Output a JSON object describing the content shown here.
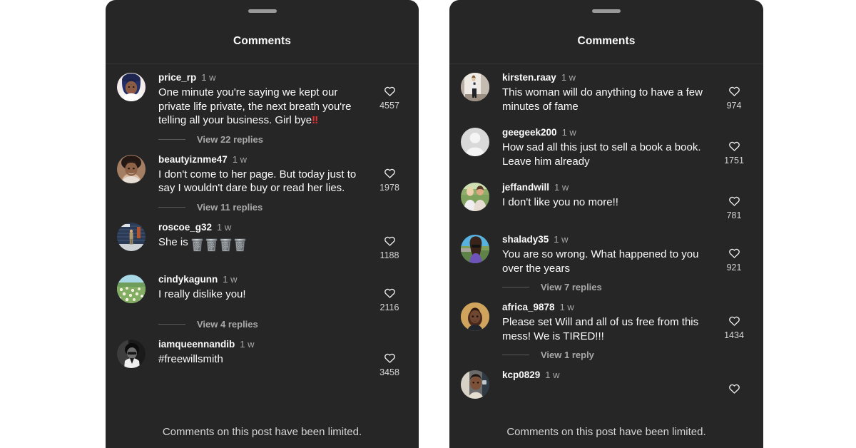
{
  "colors": {
    "page_background": "#ffffff",
    "sheet_background": "#262626",
    "primary_text": "#fafafa",
    "secondary_text": "#a8a8a8",
    "divider": "#333333",
    "accent_red": "#ef2f2f",
    "drag_handle": "#9a9a9a"
  },
  "panels": [
    {
      "id": "left",
      "title": "Comments",
      "drag_handle_name": "drag-handle",
      "footer_note": "Comments on this post have been limited.",
      "comments": [
        {
          "username": "price_rp",
          "age": "1 w",
          "text": "One minute you're saying we kept our private life private, the next breath you're telling all your business. Girl bye",
          "emoji_suffix": "‼",
          "likes": "4557",
          "replies_label": "View 22 replies",
          "avatar_type": "photo-woman-blue-hair"
        },
        {
          "username": "beautyiznme47",
          "age": "1 w",
          "text": "I don't come to her page. But today just to say I wouldn't dare buy or read her lies.",
          "likes": "1978",
          "replies_label": "View 11 replies",
          "avatar_type": "photo-woman-smiling"
        },
        {
          "username": "roscoe_g32",
          "age": "1 w",
          "text": "She is",
          "trash_emoji_count": 4,
          "likes": "1188",
          "replies_label": "",
          "avatar_type": "photo-man-standing"
        },
        {
          "username": "cindykagunn",
          "age": "1 w",
          "text": "I really dislike you!",
          "likes": "2116",
          "replies_label": "View 4 replies",
          "avatar_type": "photo-daisy-field"
        },
        {
          "username": "iamqueennandib",
          "age": "1 w",
          "text": "#freewillsmith",
          "likes": "3458",
          "replies_label": "",
          "avatar_type": "photo-bw-portrait"
        }
      ]
    },
    {
      "id": "right",
      "title": "Comments",
      "drag_handle_name": "drag-handle",
      "footer_note": "Comments on this post have been limited.",
      "comments": [
        {
          "username": "kirsten.raay",
          "age": "1 w",
          "text": "This woman will do anything to have a few minutes of fame",
          "likes": "974",
          "replies_label": "",
          "avatar_type": "photo-mirror-selfie"
        },
        {
          "username": "geegeek200",
          "age": "1 w",
          "text": "How sad all this just to sell a book a book. Leave him already",
          "likes": "1751",
          "replies_label": "",
          "avatar_type": "default-placeholder"
        },
        {
          "username": "jeffandwill",
          "age": "1 w",
          "text": "I don't like you no more!!",
          "likes": "781",
          "replies_label": "",
          "avatar_type": "photo-couple"
        },
        {
          "username": "shalady35",
          "age": "1 w",
          "text": "You are so wrong. What happened to you over the years",
          "likes": "921",
          "replies_label": "View 7 replies",
          "avatar_type": "photo-woman-sunglasses"
        },
        {
          "username": "africa_9878",
          "age": "1 w",
          "text": "Please set Will and all of us free from this mess! We is TIRED!!!",
          "likes": "1434",
          "replies_label": "View 1 reply",
          "avatar_type": "photo-woman-portrait"
        },
        {
          "username": "kcp0829",
          "age": "1 w",
          "text": "",
          "likes": "",
          "replies_label": "",
          "avatar_type": "photo-girl-partial"
        }
      ]
    }
  ]
}
